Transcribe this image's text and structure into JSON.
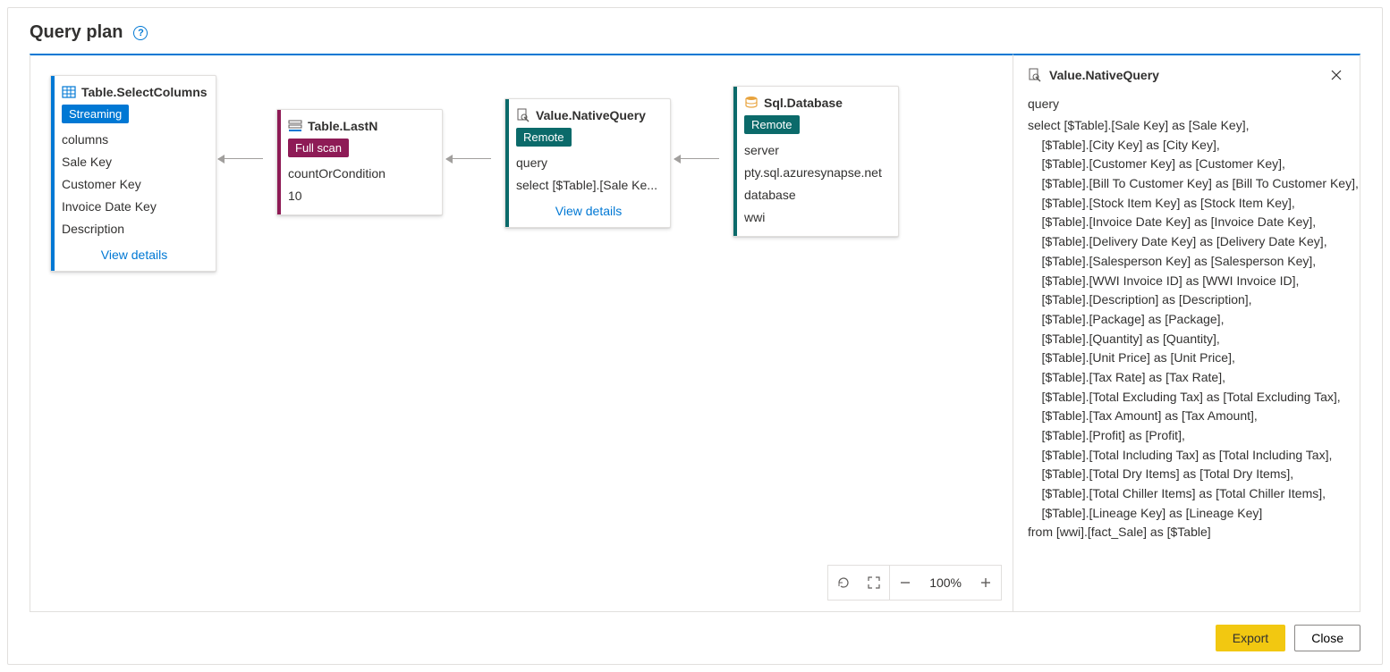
{
  "header": {
    "title": "Query plan"
  },
  "zoom": {
    "level": "100%"
  },
  "nodes": {
    "n1": {
      "title": "Table.SelectColumns",
      "badge": "Streaming",
      "rows": [
        "columns",
        "Sale Key",
        "Customer Key",
        "Invoice Date Key",
        "Description"
      ],
      "view_details": "View details"
    },
    "n2": {
      "title": "Table.LastN",
      "badge": "Full scan",
      "rows": [
        "countOrCondition",
        "10"
      ]
    },
    "n3": {
      "title": "Value.NativeQuery",
      "badge": "Remote",
      "rows": [
        "query",
        "select [$Table].[Sale Ke..."
      ],
      "view_details": "View details"
    },
    "n4": {
      "title": "Sql.Database",
      "badge": "Remote",
      "rows": [
        "server",
        "pty.sql.azuresynapse.net",
        "database",
        "wwi"
      ]
    }
  },
  "details": {
    "title": "Value.NativeQuery",
    "label": "query",
    "sql": "select [$Table].[Sale Key] as [Sale Key],\n    [$Table].[City Key] as [City Key],\n    [$Table].[Customer Key] as [Customer Key],\n    [$Table].[Bill To Customer Key] as [Bill To Customer Key],\n    [$Table].[Stock Item Key] as [Stock Item Key],\n    [$Table].[Invoice Date Key] as [Invoice Date Key],\n    [$Table].[Delivery Date Key] as [Delivery Date Key],\n    [$Table].[Salesperson Key] as [Salesperson Key],\n    [$Table].[WWI Invoice ID] as [WWI Invoice ID],\n    [$Table].[Description] as [Description],\n    [$Table].[Package] as [Package],\n    [$Table].[Quantity] as [Quantity],\n    [$Table].[Unit Price] as [Unit Price],\n    [$Table].[Tax Rate] as [Tax Rate],\n    [$Table].[Total Excluding Tax] as [Total Excluding Tax],\n    [$Table].[Tax Amount] as [Tax Amount],\n    [$Table].[Profit] as [Profit],\n    [$Table].[Total Including Tax] as [Total Including Tax],\n    [$Table].[Total Dry Items] as [Total Dry Items],\n    [$Table].[Total Chiller Items] as [Total Chiller Items],\n    [$Table].[Lineage Key] as [Lineage Key]\nfrom [wwi].[fact_Sale] as [$Table]"
  },
  "footer": {
    "export": "Export",
    "close": "Close"
  }
}
